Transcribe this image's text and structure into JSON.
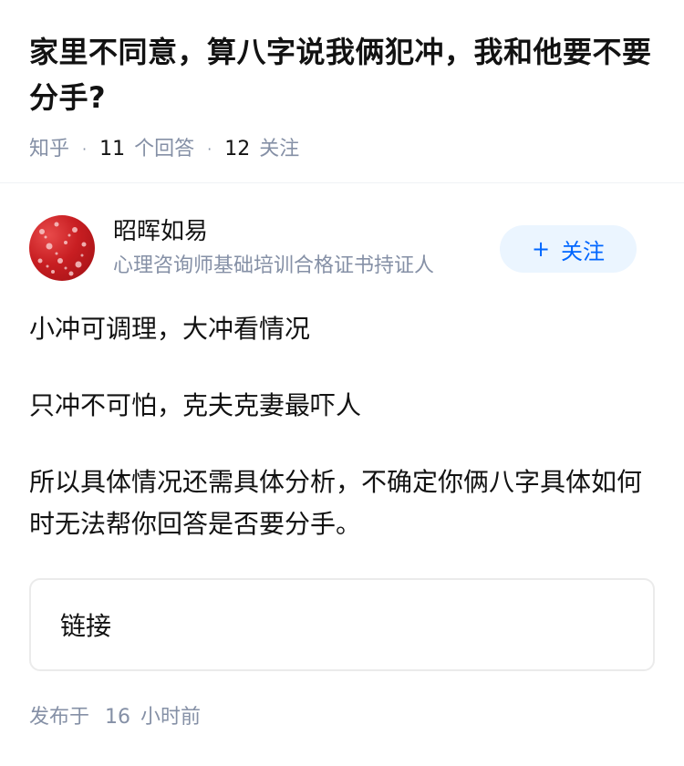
{
  "question": {
    "title": "家里不同意，算八字说我俩犯冲，我和他要不要分手?",
    "source": "知乎",
    "answers_count": "11",
    "answers_label": "个回答",
    "followers_count": "12",
    "followers_label": "关注"
  },
  "author": {
    "name": "昭晖如易",
    "bio": "心理咨询师基础培训合格证书持证人",
    "follow_plus": "+",
    "follow_label": "关注",
    "avatar_color": "#c81e22"
  },
  "answer": {
    "paragraphs": [
      "小冲可调理，大冲看情况",
      "只冲不可怕，克夫克妻最吓人",
      "所以具体情况还需具体分析，不确定你俩八字具体如何时无法帮你回答是否要分手。"
    ],
    "link_label": "链接"
  },
  "footer": {
    "published_prefix": "发布于",
    "published_num": "16",
    "published_unit": "小时前"
  },
  "colors": {
    "accent": "#0066ff",
    "accent_bg": "#ebf5ff",
    "meta": "#8590a6",
    "text": "#121212"
  }
}
